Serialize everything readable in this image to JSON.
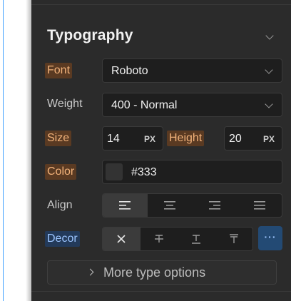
{
  "section": {
    "title": "Typography"
  },
  "font": {
    "label": "Font",
    "value": "Roboto"
  },
  "weight": {
    "label": "Weight",
    "value": "400 - Normal"
  },
  "size": {
    "label": "Size",
    "value": "14",
    "unit": "PX"
  },
  "height": {
    "label": "Height",
    "value": "20",
    "unit": "PX"
  },
  "color": {
    "label": "Color",
    "value": "#333",
    "swatch": "#333333"
  },
  "align": {
    "label": "Align",
    "options": [
      "align-left-icon",
      "align-center-icon",
      "align-right-icon",
      "align-justify-icon"
    ],
    "selected": "align-left-icon"
  },
  "decor": {
    "label": "Decor",
    "options": [
      "none-icon",
      "strikethrough-icon",
      "underline-icon",
      "overline-icon"
    ],
    "selected": "none-icon",
    "more": "···"
  },
  "more_options": {
    "label": "More type options"
  },
  "colors": {
    "panel": "#2b2b2b",
    "set_label_bg": "#5a3a22",
    "set_label_text": "#f2b27a",
    "accent_blue": "#234a74"
  }
}
